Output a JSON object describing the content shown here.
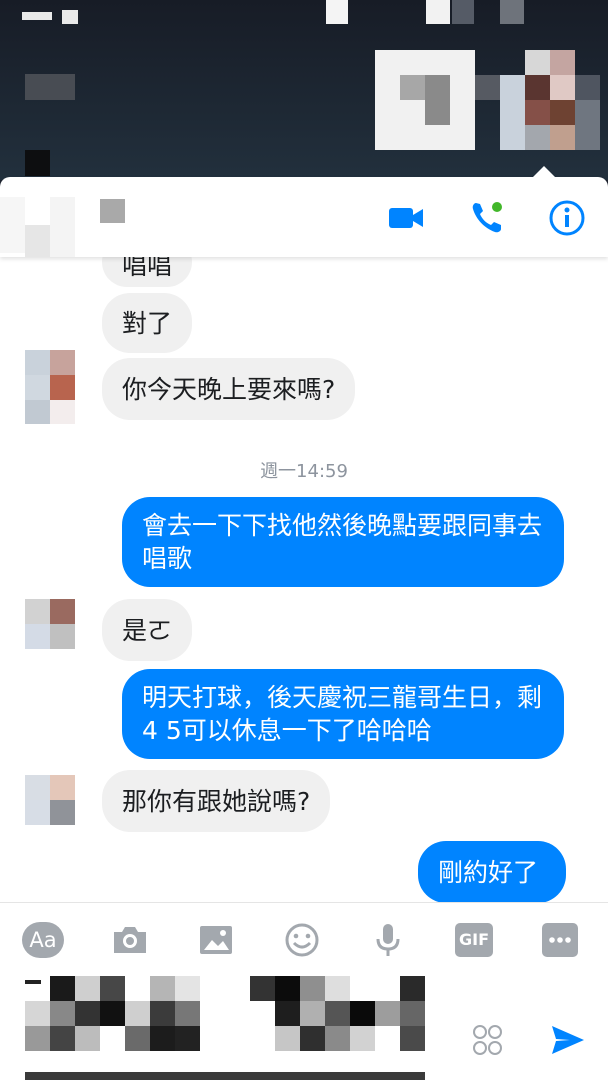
{
  "header": {
    "video_call_icon": "video-camera-icon",
    "voice_call_icon": "phone-icon",
    "info_icon": "info-icon"
  },
  "messages": [
    {
      "from": "them",
      "text": "唱唱"
    },
    {
      "from": "them",
      "text": "對了"
    },
    {
      "from": "them",
      "text": "你今天晚上要來嗎?"
    },
    {
      "from": "me",
      "text": "會去一下下找他然後晚點要跟同事去唱歌"
    },
    {
      "from": "them",
      "text": "是ㄛ"
    },
    {
      "from": "me",
      "text": "明天打球，後天慶祝三龍哥生日，剩4 5可以休息一下了哈哈哈"
    },
    {
      "from": "them",
      "text": "那你有跟她說嗎?"
    },
    {
      "from": "me",
      "text": "剛約好了"
    }
  ],
  "timestamp": "週一14:59",
  "composer": {
    "aa_label": "Aa",
    "gif_label": "GIF",
    "icons": [
      "camera-icon",
      "image-icon",
      "emoji-icon",
      "microphone-icon",
      "more-icon"
    ]
  },
  "colors": {
    "accent": "#0084ff",
    "bubble_received": "#f0f0f0"
  }
}
